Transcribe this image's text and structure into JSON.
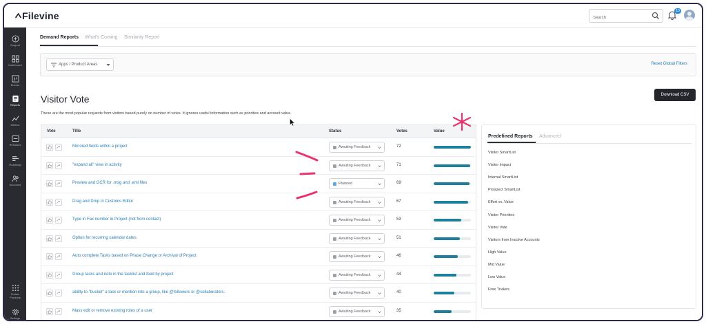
{
  "app": {
    "brand": "Filevine",
    "search_placeholder": "Search",
    "notification_count": "10"
  },
  "sidebar": {
    "items": [
      {
        "label": "Support",
        "icon": "plus-circle-icon"
      },
      {
        "label": "Dashboard",
        "icon": "grid-icon"
      },
      {
        "label": "Boards",
        "icon": "board-icon"
      },
      {
        "label": "Reports",
        "icon": "reports-icon",
        "active": true
      },
      {
        "label": "Metrics",
        "icon": "metrics-icon"
      },
      {
        "label": "Releases",
        "icon": "releases-icon"
      },
      {
        "label": "Roadmap",
        "icon": "roadmap-icon"
      },
      {
        "label": "Accounts",
        "icon": "accounts-icon"
      }
    ],
    "bottom": [
      {
        "label": "Portals Products",
        "icon": "apps-grid-icon"
      },
      {
        "label": "Settings",
        "icon": "gear-icon"
      }
    ]
  },
  "tabs": [
    "Demand Reports",
    "What's Coming",
    "Similarity Report"
  ],
  "filters": {
    "apps_label": "Apps / Product Areas",
    "reset_label": "Reset Global Filters"
  },
  "page": {
    "title": "Visitor Vote",
    "download_label": "Download CSV",
    "description": "These are the most popular requests from visitors based purely on number of votes. It ignores useful information such as priorities and account value."
  },
  "table": {
    "headers": [
      "Vote",
      "Title",
      "Status",
      "Votes",
      "Value"
    ],
    "rows": [
      {
        "title": "Mirrored fields within a project",
        "status": "Awaiting Feedback",
        "votes": "72",
        "value": 1.0
      },
      {
        "title": "\"expand all\" view in activity",
        "status": "Awaiting Feedback",
        "votes": "71",
        "value": 0.99
      },
      {
        "title": "Preview and OCR for .msg and .eml files",
        "status": "Planned",
        "votes": "69",
        "value": 0.96
      },
      {
        "title": "Drag and Drop in Customs Editor",
        "status": "Awaiting Feedback",
        "votes": "67",
        "value": 0.93
      },
      {
        "title": "Type in Fax number in Project (not from contact)",
        "status": "Awaiting Feedback",
        "votes": "53",
        "value": 0.74
      },
      {
        "title": "Option for recurring calendar dates",
        "status": "Awaiting Feedback",
        "votes": "51",
        "value": 0.71
      },
      {
        "title": "Auto complete Tasks based on Phase Change or Archival of Project",
        "status": "Awaiting Feedback",
        "votes": "46",
        "value": 0.64
      },
      {
        "title": "Group tasks and note in the tasklist and feed by project",
        "status": "Awaiting Feedback",
        "votes": "44",
        "value": 0.61
      },
      {
        "title": "ability to \"bucket\" a task or mention into a group, like @followers or @collaborators.",
        "status": "Awaiting Feedback",
        "votes": "40",
        "value": 0.56
      },
      {
        "title": "Mass edit or remove existing roles of a user",
        "status": "Awaiting Feedback",
        "votes": "35",
        "value": 0.49
      }
    ]
  },
  "panel": {
    "tabs": [
      "Predefined Reports",
      "Advanced"
    ],
    "items": [
      "Visitor SmartList",
      "Visitor Impact",
      "Internal SmartList",
      "Prospect SmartList",
      "Effort vs. Value",
      "Visitor Priorities",
      "Visitor Vote",
      "Visitors from Inactive Accounts",
      "High Value",
      "Mid Value",
      "Low Value",
      "Free Trialers"
    ]
  },
  "colors": {
    "accent_link": "#2a7fb4",
    "value_bar": "#1f7f9a",
    "sidebar_bg": "#2a2b30",
    "annotation": "#e8336d"
  }
}
